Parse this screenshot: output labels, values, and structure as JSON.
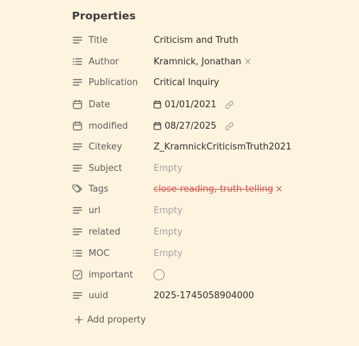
{
  "section_title": "Properties",
  "properties": [
    {
      "key": "Title",
      "icon": "text-icon",
      "value": "Criticism and Truth"
    },
    {
      "key": "Author",
      "icon": "list-icon",
      "value": "Kramnick, Jonathan",
      "remove": "×"
    },
    {
      "key": "Publication",
      "icon": "text-icon",
      "value": "Critical Inquiry"
    },
    {
      "key": "Date",
      "icon": "calendar-icon",
      "value": "01/01/2021"
    },
    {
      "key": "modified",
      "icon": "calendar-icon",
      "value": "08/27/2025"
    },
    {
      "key": "Citekey",
      "icon": "text-icon",
      "value": "Z_KramnickCriticismTruth2021"
    },
    {
      "key": "Subject",
      "icon": "text-icon",
      "value": "Empty"
    },
    {
      "key": "Tags",
      "icon": "tags-icon",
      "value": "close-reading, truth-telling",
      "remove": "×"
    },
    {
      "key": "url",
      "icon": "text-icon",
      "value": "Empty"
    },
    {
      "key": "related",
      "icon": "text-icon",
      "value": "Empty"
    },
    {
      "key": "MOC",
      "icon": "list-icon",
      "value": "Empty"
    },
    {
      "key": "important",
      "icon": "checkbox-icon",
      "checked": false
    },
    {
      "key": "uuid",
      "icon": "text-icon",
      "value": "2025-1745058904000"
    }
  ],
  "add_property_label": "Add property",
  "colors": {
    "background": "#fcf4df",
    "text": "#2e2e2e",
    "muted": "#5f5f5f",
    "empty": "#a3a3a3",
    "tag_error": "#d9534f"
  }
}
